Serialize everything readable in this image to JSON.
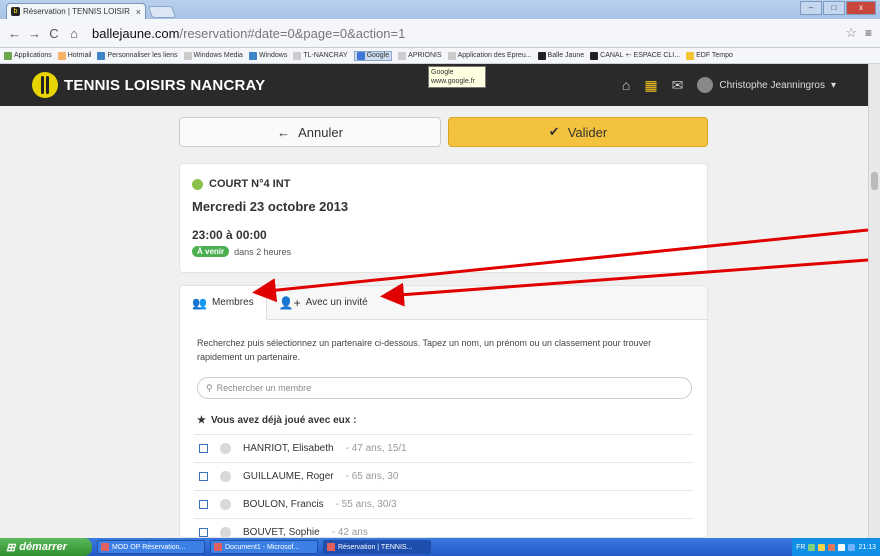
{
  "browser": {
    "tab_title": "Réservation | TENNIS LOISIR",
    "tab_close": "×",
    "url_host": "balle­jaune.com",
    "url_path": "/reservation#date=0&page=0&action=1",
    "back": "←",
    "forward": "→",
    "reload": "C",
    "home": "⌂",
    "star": "☆",
    "menu": "≡",
    "win_min": "–",
    "win_max": "□",
    "win_close": "x",
    "bookmarks": [
      {
        "label": "Applications",
        "color": "#6aa84f"
      },
      {
        "label": "Hotmail",
        "color": "#f6b26b"
      },
      {
        "label": "Personnaliser les liens",
        "color": "#3d85c6"
      },
      {
        "label": "Windows Media",
        "color": "#cccccc"
      },
      {
        "label": "Windows",
        "color": "#3d85c6"
      },
      {
        "label": "TL-NANCRAY",
        "color": "#cccccc"
      },
      {
        "label": "Google",
        "color": "#3c78d8"
      },
      {
        "label": "APRIONIS",
        "color": "#cccccc"
      },
      {
        "label": "Application des Epreu...",
        "color": "#cccccc"
      },
      {
        "label": "Balle Jaune",
        "color": "#222222"
      },
      {
        "label": "CANAL +- ESPACE CLI...",
        "color": "#222222"
      },
      {
        "label": "EDF Tempo",
        "color": "#f1c232"
      }
    ],
    "tooltip_title": "Google",
    "tooltip_url": "www.google.fr"
  },
  "app": {
    "brand": "TENNIS LOISIRS NANCRAY",
    "home_icon": "⌂",
    "calendar_icon": "▦",
    "chat_icon": "✉",
    "user_name": "Christophe Jeanningros",
    "user_caret": "▾"
  },
  "actions": {
    "cancel_icon": "←",
    "cancel_label": "Annuler",
    "validate_icon": "✔",
    "validate_label": "Valider"
  },
  "booking": {
    "court": "COURT N°4 INT",
    "date": "Mercredi 23 octobre 2013",
    "time": "23:00 à 00:00",
    "status_badge": "À venir",
    "status_text": "dans 2 heures"
  },
  "partners": {
    "tab_members": "Membres",
    "tab_guest": "Avec un invité",
    "description": "Recherchez puis sélectionnez un partenaire ci-dessous. Tapez un nom, un prénom ou un classement pour trouver rapidement un partenaire.",
    "search_icon": "⚲",
    "search_placeholder": "Rechercher un membre",
    "played_icon": "★",
    "played_heading": "Vous avez déjà joué avec eux :",
    "members": [
      {
        "name": "HANRIOT, Elisabeth",
        "info": "- 47 ans, 15/1"
      },
      {
        "name": "GUILLAUME, Roger",
        "info": "- 65 ans, 30"
      },
      {
        "name": "BOULON, Francis",
        "info": "- 55 ans, 30/3"
      },
      {
        "name": "BOUVET, Sophie",
        "info": "- 42 ans"
      }
    ]
  },
  "taskbar": {
    "start": "démarrer",
    "tasks": [
      "MOD OP Réservation...",
      "Document1 - Microsof...",
      "Réservation | TENNIS..."
    ],
    "lang": "FR",
    "clock": "21:13"
  }
}
